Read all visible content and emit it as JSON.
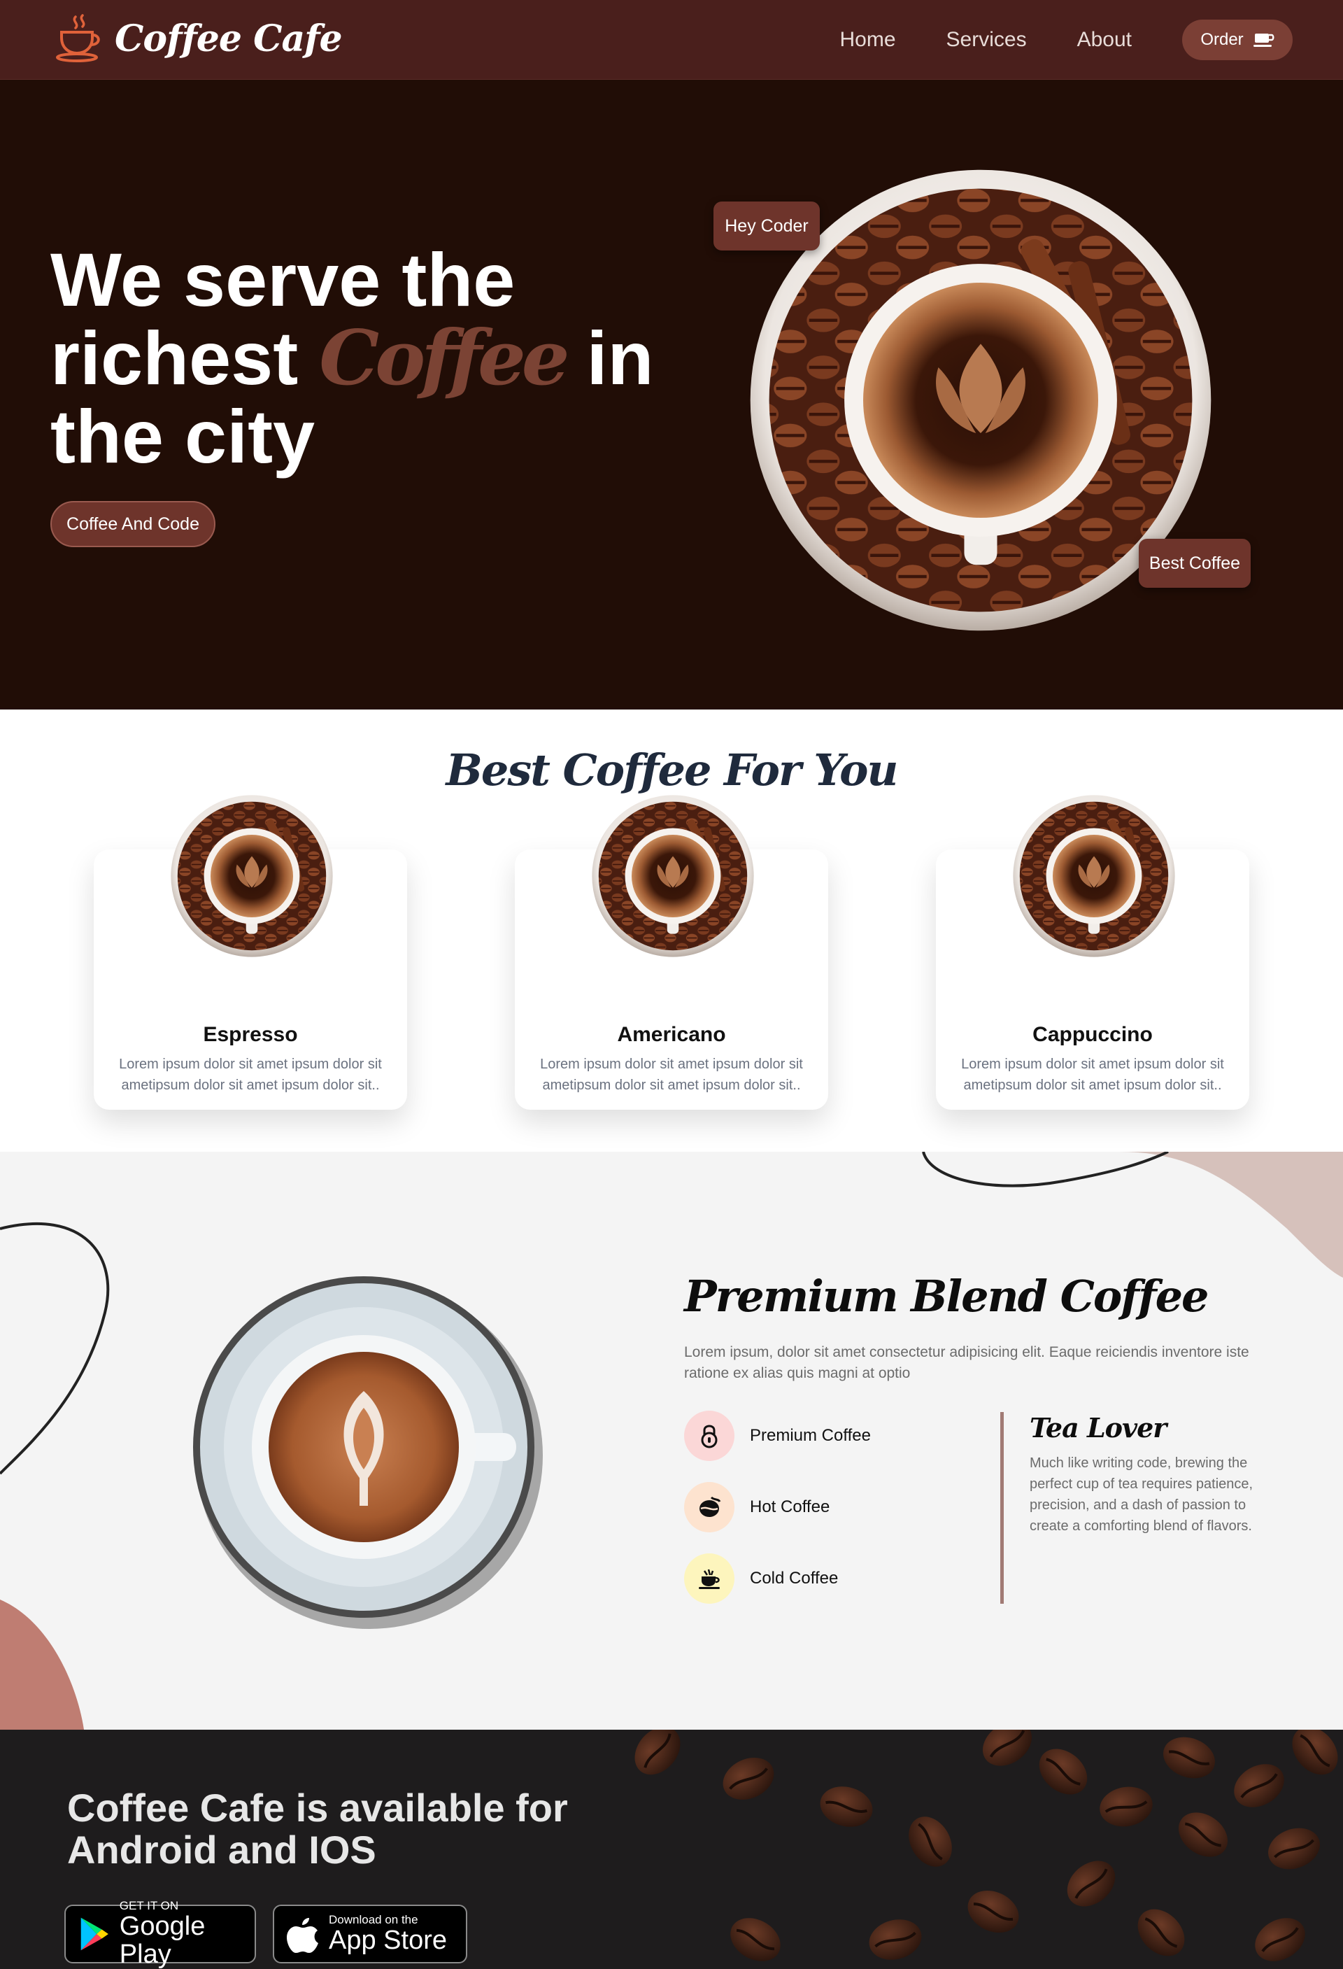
{
  "nav": {
    "brand": "Coffee Cafe",
    "links": [
      "Home",
      "Services",
      "About"
    ],
    "order_label": "Order"
  },
  "hero": {
    "title_line1": "We serve the",
    "title_line2_start": "richest",
    "title_coffee": "Coffee",
    "title_line2_end": "in",
    "title_line3": "the city",
    "button": "Coffee And Code",
    "tag_top": "Hey Coder",
    "tag_bottom": "Best Coffee"
  },
  "best": {
    "heading": "Best Coffee For You",
    "cards": [
      {
        "title": "Espresso",
        "desc": "Lorem ipsum dolor sit amet ipsum dolor sit ametipsum dolor sit amet ipsum dolor sit.."
      },
      {
        "title": "Americano",
        "desc": "Lorem ipsum dolor sit amet ipsum dolor sit ametipsum dolor sit amet ipsum dolor sit.."
      },
      {
        "title": "Cappuccino",
        "desc": "Lorem ipsum dolor sit amet ipsum dolor sit ametipsum dolor sit amet ipsum dolor sit.."
      }
    ]
  },
  "premium": {
    "title": "Premium Blend Coffee",
    "desc": "Lorem ipsum, dolor sit amet consectetur adipisicing elit. Eaque reiciendis inventore iste ratione ex alias quis magni at optio",
    "features": [
      "Premium Coffee",
      "Hot Coffee",
      "Cold Coffee"
    ],
    "tea_title": "Tea Lover",
    "tea_desc": "Much like writing code, brewing the perfect cup of tea requires patience, precision, and a dash of passion to create a comforting blend of flavors."
  },
  "app": {
    "title": "Coffee Cafe is available for Android and IOS",
    "google_small": "GET IT ON",
    "google_big": "Google Play",
    "apple_small": "Download on the",
    "apple_big": "App Store"
  },
  "colors": {
    "nav_bg": "#4a1f1c",
    "hero_bg": "#210d06",
    "accent": "#6e342b",
    "coffee_text": "#7b4334"
  }
}
